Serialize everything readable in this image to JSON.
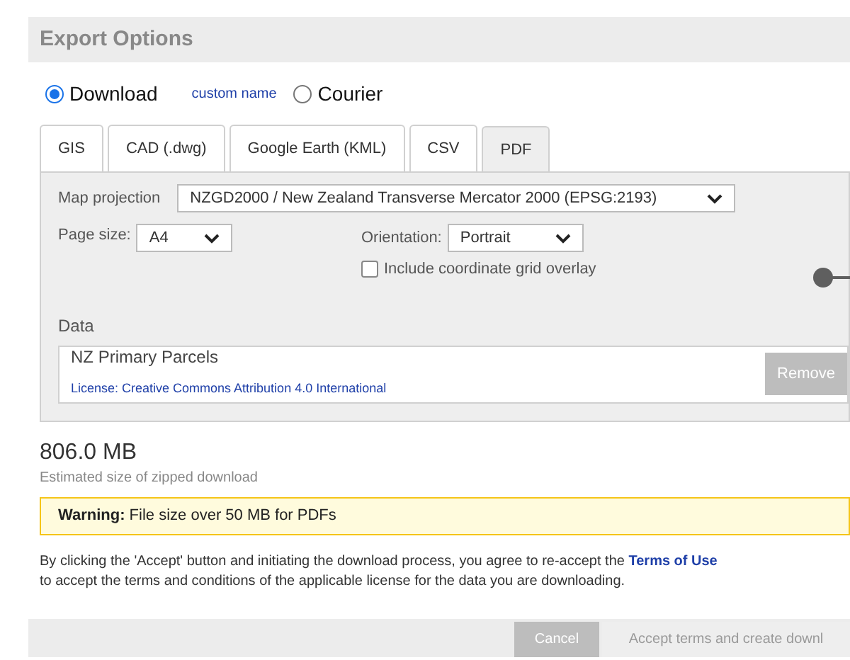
{
  "title": "Export Options",
  "delivery": [
    {
      "label": "Download",
      "selected": true
    },
    {
      "label": "Courier",
      "selected": false
    }
  ],
  "custom_name_link": "custom name",
  "tabs": [
    {
      "label": "GIS",
      "selected": false
    },
    {
      "label": "CAD (.dwg)",
      "selected": false
    },
    {
      "label": "Google Earth (KML)",
      "selected": false
    },
    {
      "label": "CSV",
      "selected": false
    },
    {
      "label": "PDF",
      "selected": true
    }
  ],
  "map_projection": {
    "label": "Map projection",
    "value": "NZGD2000 / New Zealand Transverse Mercator 2000 (EPSG:2193)"
  },
  "page_size": {
    "label": "Page size:",
    "value": "A4"
  },
  "orientation": {
    "label": "Orientation:",
    "value": "Portrait"
  },
  "grid_overlay": {
    "label": "Include coordinate grid overlay",
    "checked": false
  },
  "data": {
    "heading": "Data",
    "items": [
      {
        "name": "NZ Primary Parcels",
        "license": "License: Creative Commons Attribution 4.0 International",
        "action": "Remove"
      }
    ]
  },
  "size": {
    "value": "806.0 MB",
    "caption": "Estimated size of zipped download"
  },
  "warning": {
    "text": "**Warning:** File size over 50 MB for PDFs"
  },
  "terms": {
    "line_1": "By clicking the 'Accept' button and initiating the download process, you agree to re-accept the",
    "link": "Terms of Use",
    "line_2": "to accept the terms and conditions of the applicable license for the data you are downloading."
  },
  "buttons": [
    {
      "label": "Cancel",
      "disabled": true
    },
    {
      "label": "Accept terms and create downl",
      "disabled": true
    }
  ]
}
